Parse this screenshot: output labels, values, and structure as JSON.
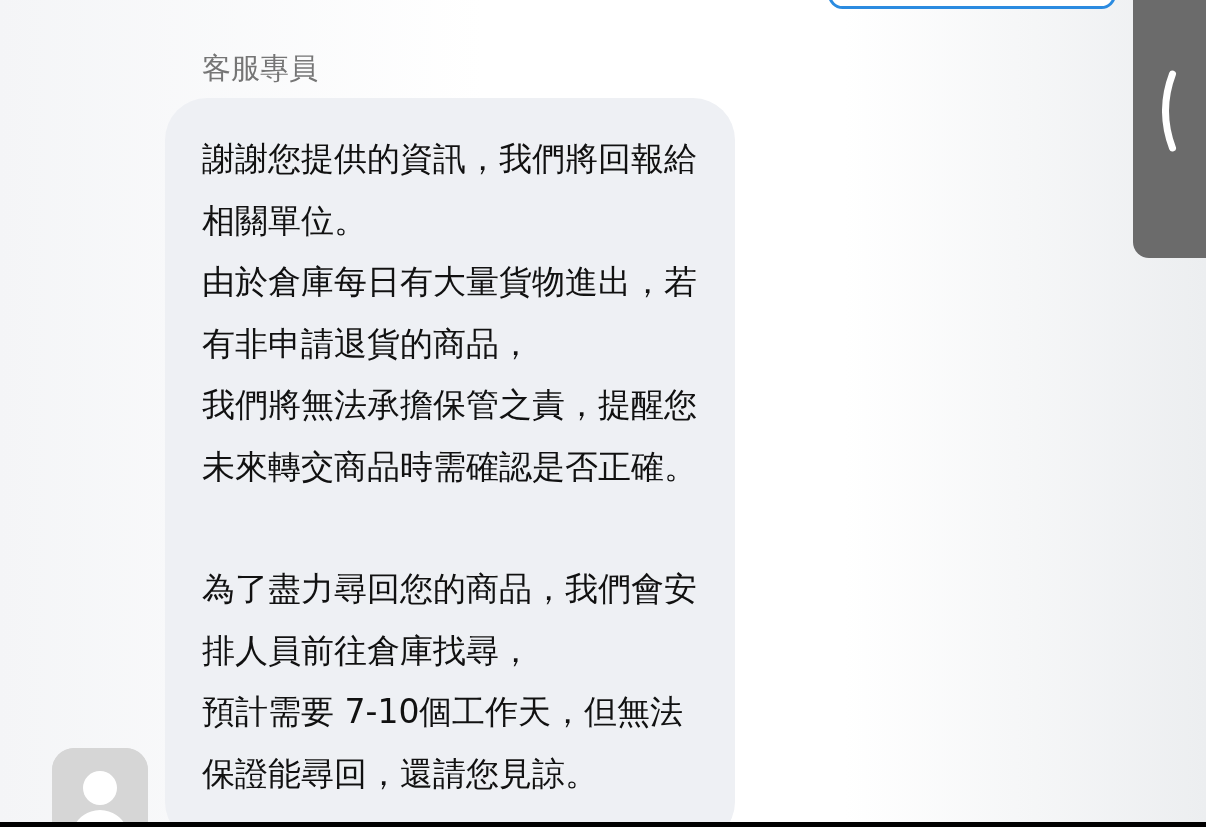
{
  "message": {
    "sender": "客服專員",
    "paragraphs": [
      {
        "lines": [
          "謝謝您提供的資訊，我們將回報給",
          "相關單位。",
          "由於倉庫每日有大量貨物進出，若",
          "有非申請退貨的商品，",
          "我們將無法承擔保管之責，提醒您",
          "未來轉交商品時需確認是否正確。"
        ]
      },
      {
        "lines": [
          "為了盡力尋回您的商品，我們會安",
          "排人員前往倉庫找尋，",
          "預計需要 7-10個工作天，但無法",
          "保證能尋回，還請您見諒。"
        ]
      }
    ]
  }
}
